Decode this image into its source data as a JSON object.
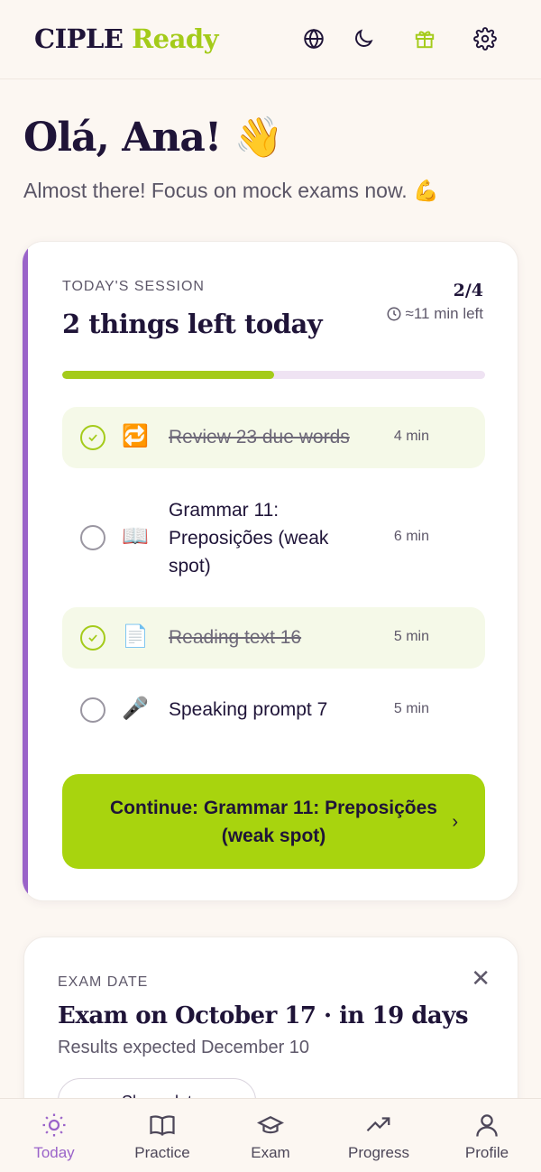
{
  "header": {
    "brand_part1": "CIPLE",
    "brand_part2": "Ready",
    "icons": [
      "globe-icon",
      "moon-icon",
      "gift-icon",
      "gear-icon"
    ]
  },
  "greeting": {
    "title": "Olá, Ana! 👋",
    "subtitle": "Almost there! Focus on mock exams now. 💪"
  },
  "session": {
    "label": "TODAY'S SESSION",
    "title": "2 things left today",
    "count": "2/4",
    "time_left": "≈11 min left",
    "progress_fraction": 0.5,
    "tasks": [
      {
        "icon": "🔁",
        "label": "Review 23 due words",
        "minutes": "4 min",
        "done": true
      },
      {
        "icon": "📖",
        "label": "Grammar 11: Preposições (weak spot)",
        "minutes": "6 min",
        "done": false
      },
      {
        "icon": "📄",
        "label": "Reading text 16",
        "minutes": "5 min",
        "done": true
      },
      {
        "icon": "🎤",
        "label": "Speaking prompt 7",
        "minutes": "5 min",
        "done": false
      }
    ],
    "cta_label": "Continue: Grammar 11: Preposições (weak spot)",
    "cta_chevron": "›"
  },
  "exam": {
    "label": "EXAM DATE",
    "title": "Exam on October 17 · in 19 days",
    "subtitle": "Results expected December 10",
    "close": "✕",
    "share_label": "Share date"
  },
  "tabs": [
    {
      "label": "Today",
      "icon": "sun-icon",
      "active": true
    },
    {
      "label": "Practice",
      "icon": "book-icon",
      "active": false
    },
    {
      "label": "Exam",
      "icon": "graduation-cap-icon",
      "active": false
    },
    {
      "label": "Progress",
      "icon": "trending-up-icon",
      "active": false
    },
    {
      "label": "Profile",
      "icon": "user-icon",
      "active": false
    }
  ],
  "colors": {
    "accent_green": "#a8d40e",
    "accent_purple": "#9a63c9",
    "text_dark": "#1f1438",
    "background": "#fcf7f2"
  }
}
